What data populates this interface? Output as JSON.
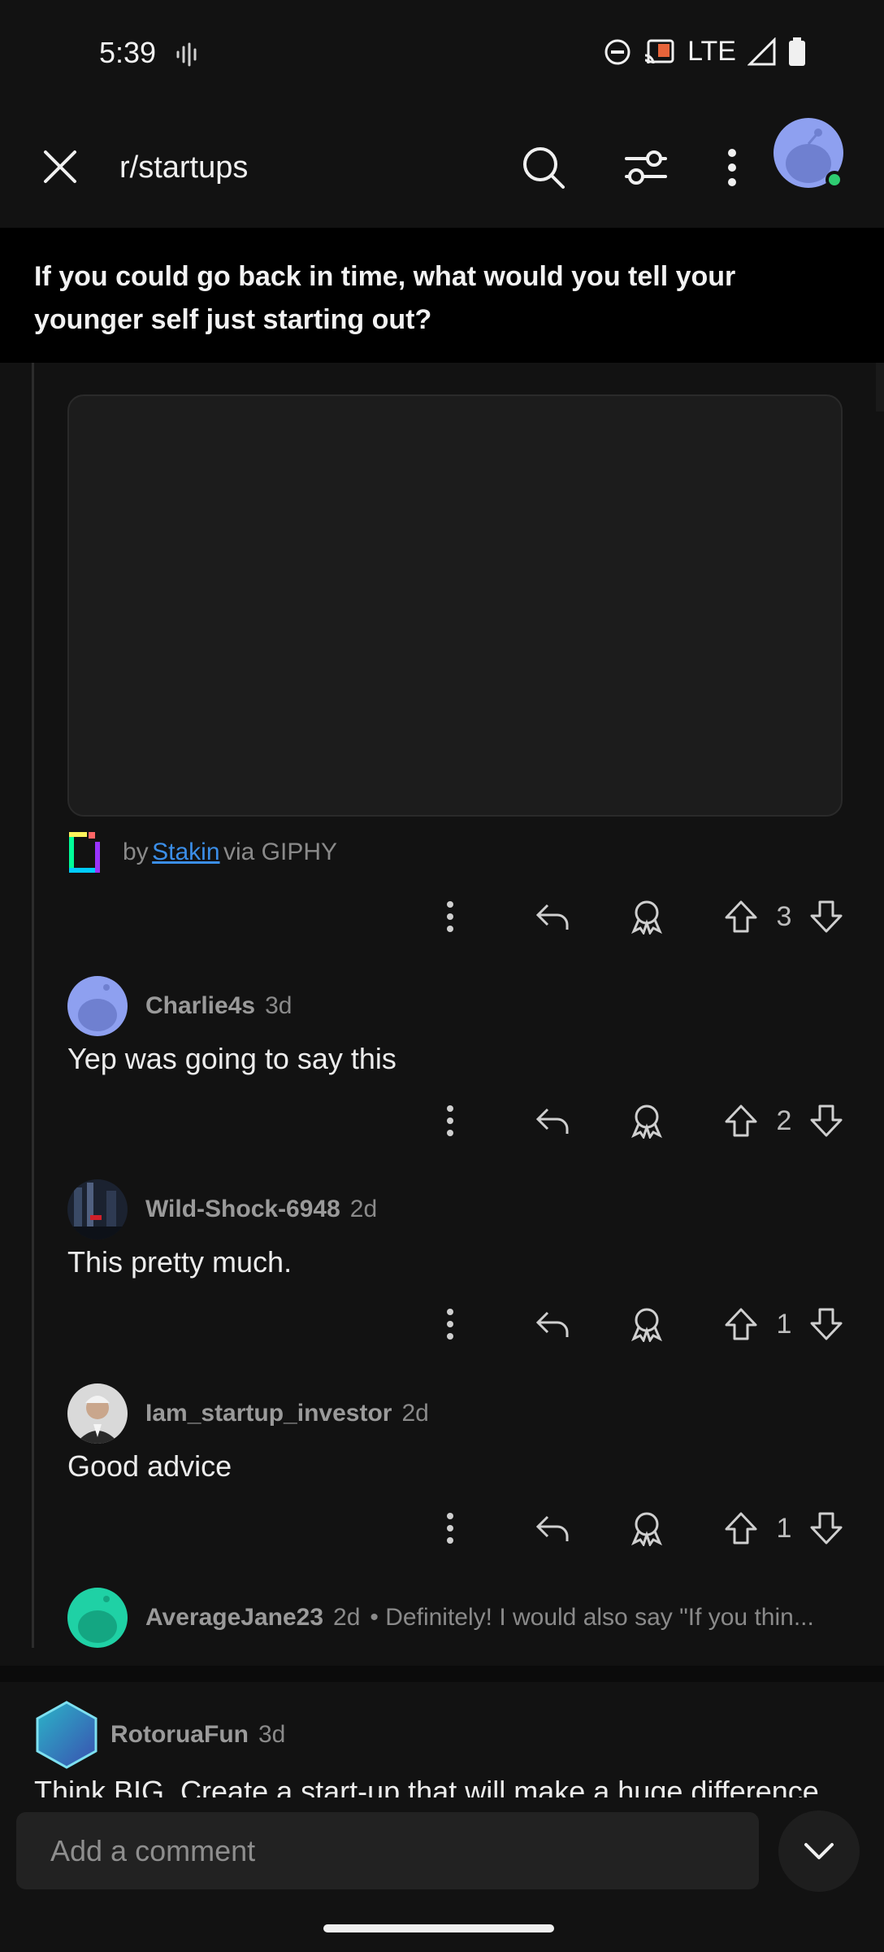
{
  "status": {
    "time": "5:39",
    "network": "LTE"
  },
  "header": {
    "subreddit": "r/startups"
  },
  "post": {
    "title": "If you could go back in time, what would you tell your younger self just starting out?"
  },
  "giphy": {
    "by": "by",
    "author": "Stakin",
    "via": "via GIPHY"
  },
  "votes": {
    "gif_comment": "3"
  },
  "comments": [
    {
      "user": "Charlie4s",
      "age": "3d",
      "text": "Yep was going to say this",
      "votes": "2",
      "avatar_color": "#8ea0f0"
    },
    {
      "user": "Wild-Shock-6948",
      "age": "2d",
      "text": "This pretty much.",
      "votes": "1",
      "avatar_color": "#1b2230"
    },
    {
      "user": "Iam_startup_investor",
      "age": "2d",
      "text": "Good advice",
      "votes": "1",
      "avatar_color": "#d9d9d9"
    }
  ],
  "collapsed_comment": {
    "user": "AverageJane23",
    "age": "2d",
    "preview": "• Definitely! I would also say \"If you thin...",
    "avatar_color": "#1fd1a5"
  },
  "top_comment": {
    "user": "RotoruaFun",
    "age": "3d",
    "text": "Think BIG. Create a start-up that will make a huge difference"
  },
  "composer": {
    "placeholder": "Add a comment"
  },
  "colors": {
    "background": "#121212",
    "link": "#3b8ee8",
    "online": "#2ecc71"
  }
}
